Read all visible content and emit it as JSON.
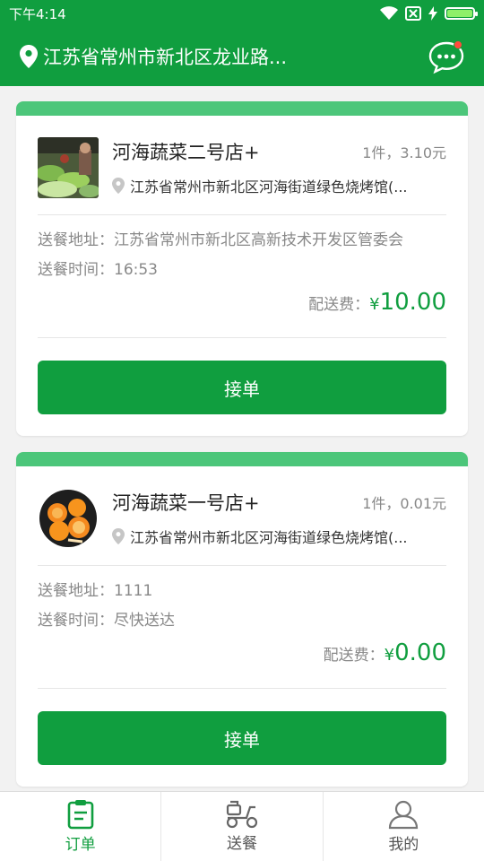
{
  "status_bar": {
    "time": "下午4:14"
  },
  "header": {
    "location": "江苏省常州市新北区龙业路..."
  },
  "orders": [
    {
      "shop_name": "河海蔬菜二号店+",
      "quantity": "1件，3.10元",
      "shop_address": "江苏省常州市新北区河海街道绿色烧烤馆(...",
      "delivery_address_label": "送餐地址：",
      "delivery_address": "江苏省常州市新北区高新技术开发区管委会",
      "delivery_time_label": "送餐时间：",
      "delivery_time": "16:53",
      "fee_label": "配送费：",
      "fee_currency": "¥",
      "fee_amount": "10.00",
      "accept_label": "接单"
    },
    {
      "shop_name": "河海蔬菜一号店+",
      "quantity": "1件，0.01元",
      "shop_address": "江苏省常州市新北区河海街道绿色烧烤馆(...",
      "delivery_address_label": "送餐地址：",
      "delivery_address": "1111",
      "delivery_time_label": "送餐时间：",
      "delivery_time": "尽快送达",
      "fee_label": "配送费：",
      "fee_currency": "¥",
      "fee_amount": "0.00",
      "accept_label": "接单"
    }
  ],
  "tabs": [
    {
      "label": "订单",
      "icon": "clipboard-icon",
      "active": true
    },
    {
      "label": "送餐",
      "icon": "scooter-icon",
      "active": false
    },
    {
      "label": "我的",
      "icon": "person-icon",
      "active": false
    }
  ],
  "colors": {
    "primary": "#109e3f",
    "card_top": "#4cc67a",
    "notify_dot": "#ff4a3d"
  }
}
